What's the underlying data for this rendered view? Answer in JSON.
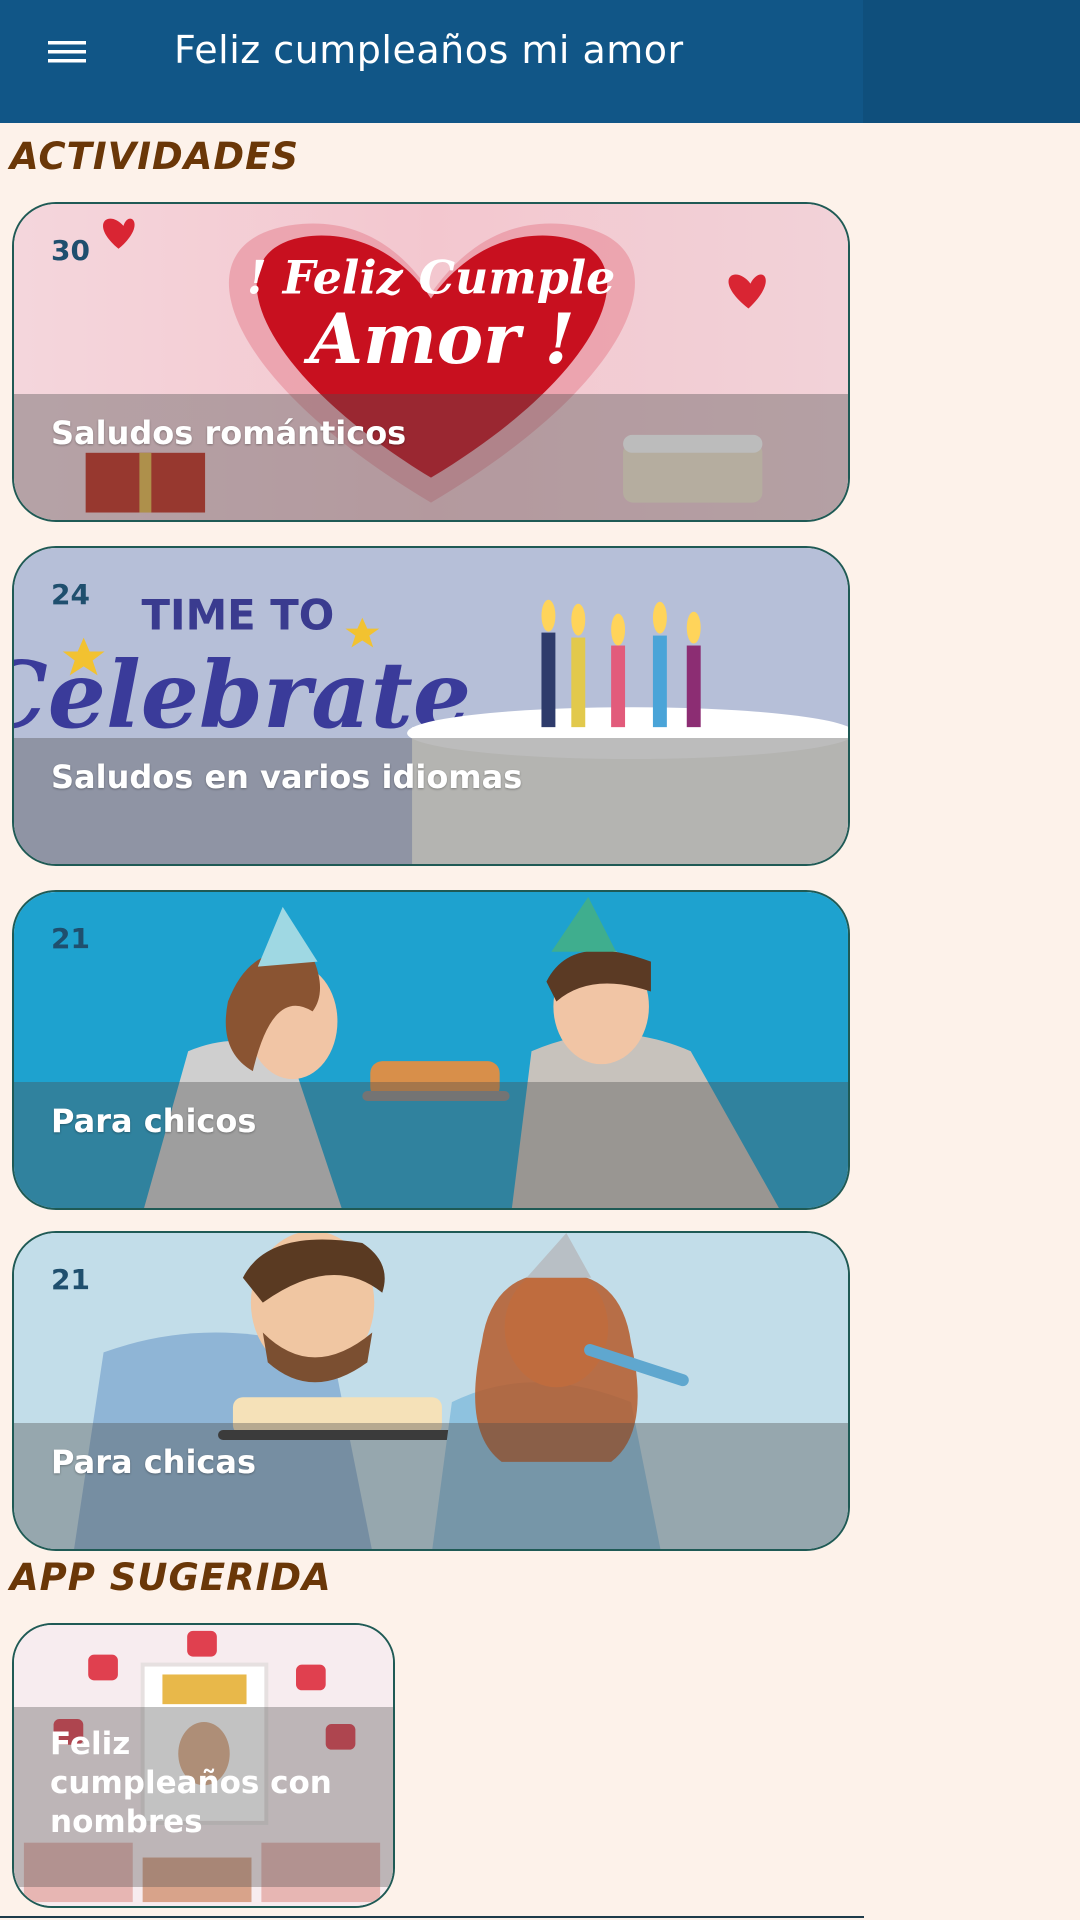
{
  "appbar": {
    "title": "Feliz cumpleaños mi amor",
    "menu_icon": "hamburger-menu-icon"
  },
  "sections": {
    "activities_title": "ACTIVIDADES",
    "suggested_title": "APP SUGERIDA"
  },
  "cards": [
    {
      "count": "30",
      "label": "Saludos románticos",
      "image": "feliz-cumple-amor-heart-image"
    },
    {
      "count": "24",
      "label": "Saludos en varios idiomas",
      "image": "time-to-celebrate-cake-image"
    },
    {
      "count": "21",
      "label": "Para chicos",
      "image": "couple-with-party-hats-image"
    },
    {
      "count": "21",
      "label": "Para chicas",
      "image": "man-with-cake-woman-blowing-horn-image"
    }
  ],
  "suggested_app": {
    "label": "Feliz cumpleaños con nombres",
    "image": "happy-birthday-frame-image"
  },
  "colors": {
    "appbar": "#115687",
    "background": "#fdf2ea",
    "section_title": "#6a3708",
    "card_border": "#1f5a55"
  }
}
